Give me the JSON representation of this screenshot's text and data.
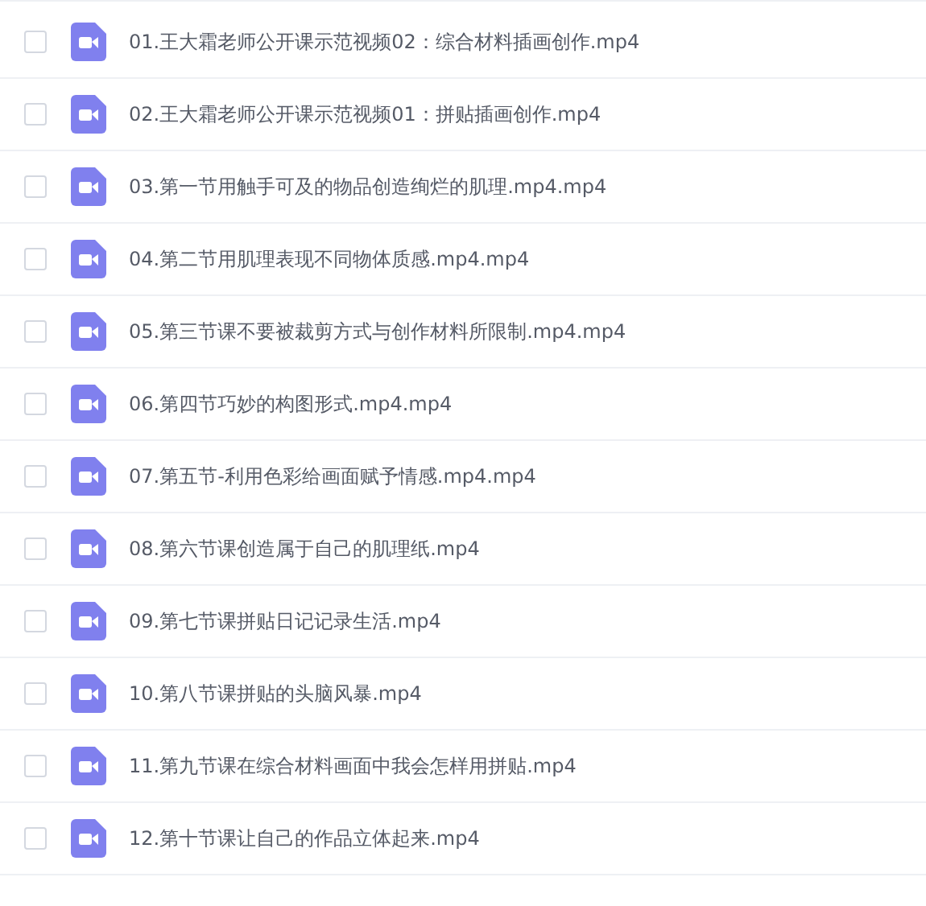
{
  "files": [
    {
      "name": "01.王大霜老师公开课示范视频02：综合材料插画创作.mp4",
      "checked": false
    },
    {
      "name": "02.王大霜老师公开课示范视频01：拼贴插画创作.mp4",
      "checked": false
    },
    {
      "name": "03.第一节用触手可及的物品创造绚烂的肌理.mp4.mp4",
      "checked": false
    },
    {
      "name": "04.第二节用肌理表现不同物体质感.mp4.mp4",
      "checked": false
    },
    {
      "name": "05.第三节课不要被裁剪方式与创作材料所限制.mp4.mp4",
      "checked": false
    },
    {
      "name": "06.第四节巧妙的构图形式.mp4.mp4",
      "checked": false
    },
    {
      "name": "07.第五节-利用色彩给画面赋予情感.mp4.mp4",
      "checked": false
    },
    {
      "name": "08.第六节课创造属于自己的肌理纸.mp4",
      "checked": false
    },
    {
      "name": "09.第七节课拼贴日记记录生活.mp4",
      "checked": false
    },
    {
      "name": "10.第八节课拼贴的头脑风暴.mp4",
      "checked": false
    },
    {
      "name": "11.第九节课在综合材料画面中我会怎样用拼贴.mp4",
      "checked": false
    },
    {
      "name": "12.第十节课让自己的作品立体起来.mp4",
      "checked": false
    }
  ]
}
